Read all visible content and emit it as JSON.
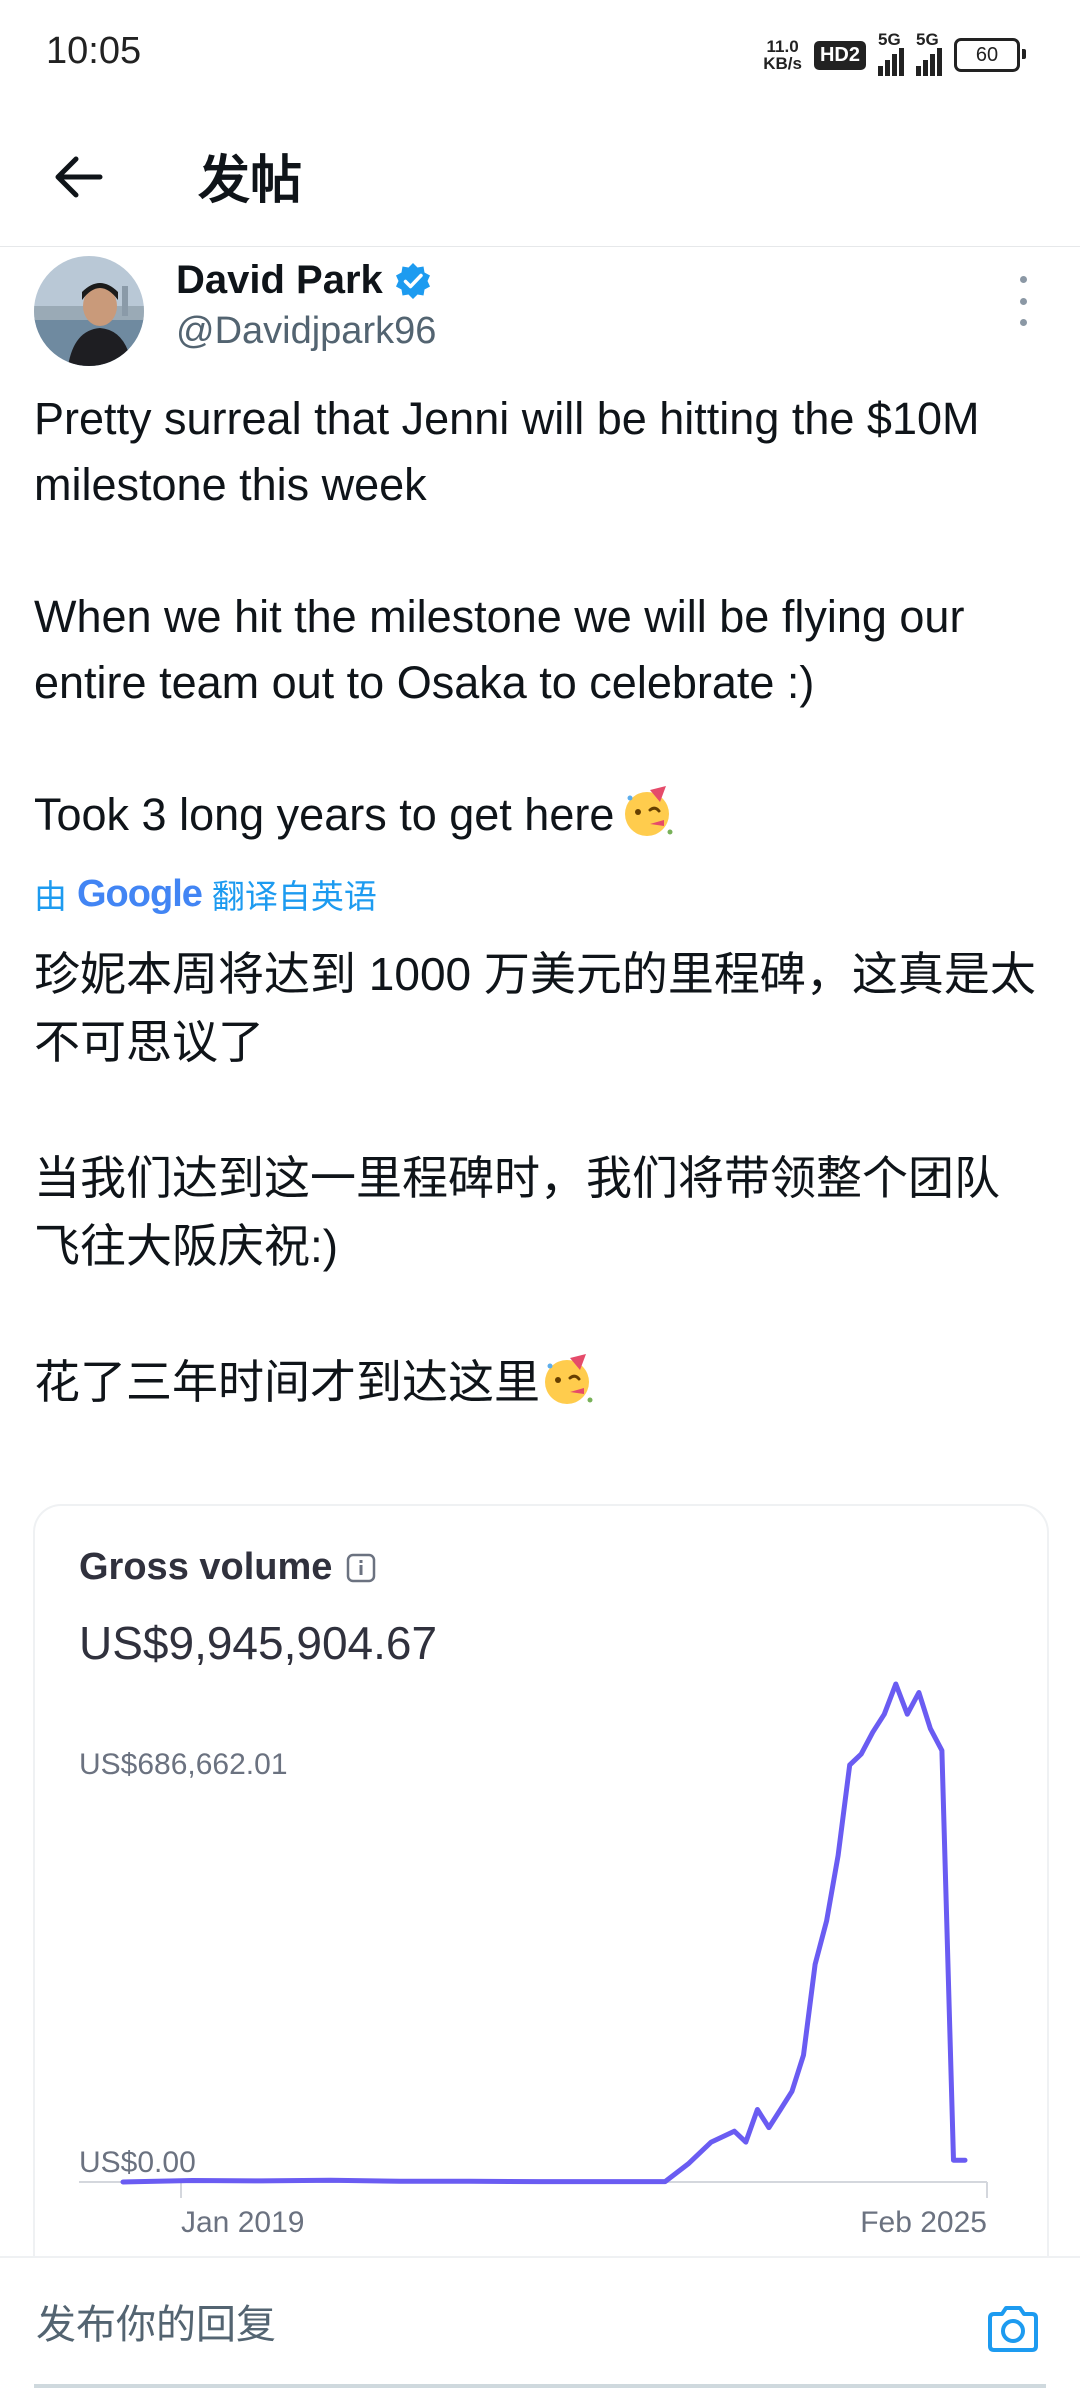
{
  "status_bar": {
    "time": "10:05",
    "net_speed_value": "11.0",
    "net_speed_unit": "KB/s",
    "hd_badge": "HD2",
    "signal_1": "5G",
    "signal_2": "5G",
    "battery": "60"
  },
  "header": {
    "title": "发帖",
    "back_icon": "arrow-left-icon"
  },
  "author": {
    "name": "David Park",
    "handle": "@Davidjpark96",
    "verified": true,
    "verified_color": "#1d9bf0"
  },
  "tweet": {
    "original": [
      "Pretty surreal that Jenni will be hitting the $10M milestone this week",
      "When we hit the milestone we will be flying our entire team out to Osaka to celebrate :)",
      "Took 3 long years to get here"
    ],
    "emoji": "partying-face",
    "translation_by": "由",
    "translation_provider": "Google",
    "translation_note": "翻译自英语",
    "translated": [
      "珍妮本周将达到 1000 万美元的里程碑，这真是太不可思议了",
      "当我们达到这一里程碑时，我们将带领整个团队飞往大阪庆祝:)",
      "花了三年时间才到达这里"
    ]
  },
  "chart_card": {
    "title": "Gross volume",
    "total": "US$9,945,904.67"
  },
  "chart_data": {
    "type": "line",
    "series": [
      {
        "color": "#6a5cf2",
        "x": [
          "2019-01",
          "2019-07",
          "2020-01",
          "2020-07",
          "2021-01",
          "2021-07",
          "2022-01",
          "2022-07",
          "2022-12",
          "2023-02",
          "2023-04",
          "2023-06",
          "2023-07",
          "2023-08",
          "2023-09",
          "2023-10",
          "2023-11",
          "2023-12",
          "2024-01",
          "2024-02",
          "2024-03",
          "2024-04",
          "2024-05",
          "2024-06",
          "2024-07",
          "2024-08",
          "2024-09",
          "2024-10",
          "2024-11",
          "2024-12",
          "2025-01",
          "2025-02"
        ],
        "values": [
          0,
          2000,
          1500,
          2500,
          1000,
          1000,
          500,
          500,
          500,
          25000,
          55000,
          70000,
          55000,
          100000,
          75000,
          100000,
          125000,
          175000,
          300000,
          360000,
          450000,
          575000,
          590000,
          620000,
          645000,
          686662,
          645000,
          675000,
          625000,
          595000,
          30000,
          30000
        ]
      }
    ],
    "y_labels": [
      "US$686,662.01",
      "US$0.00"
    ],
    "ylim": [
      0,
      686662.01
    ],
    "x_labels": [
      "Jan 2019",
      "Feb 2025"
    ],
    "grid": false
  },
  "reply": {
    "placeholder": "发布你的回复",
    "camera_icon": "camera-icon",
    "accent": "#1d9bf0"
  }
}
